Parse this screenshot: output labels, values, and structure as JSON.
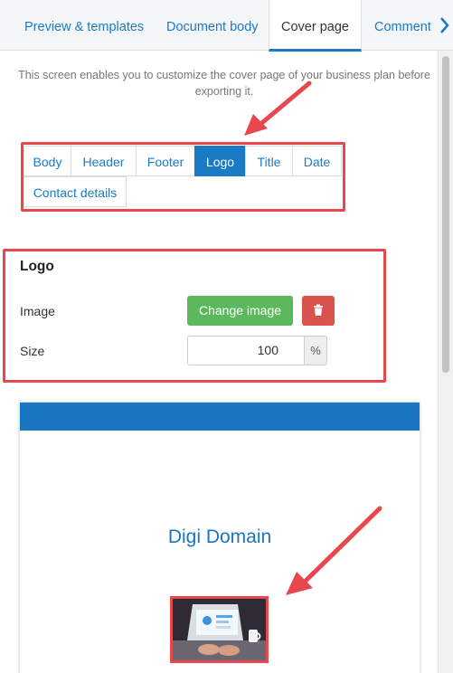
{
  "tabs": {
    "items": [
      {
        "label": "Preview & templates"
      },
      {
        "label": "Document body"
      },
      {
        "label": "Cover page",
        "active": true
      },
      {
        "label": "Comments"
      }
    ]
  },
  "intro_text": "This screen enables you to customize the cover page of your business plan before exporting it.",
  "subtabs": {
    "items": [
      {
        "label": "Body"
      },
      {
        "label": "Header"
      },
      {
        "label": "Footer"
      },
      {
        "label": "Logo",
        "active": true
      },
      {
        "label": "Title"
      },
      {
        "label": "Date"
      },
      {
        "label": "Contact details"
      }
    ]
  },
  "logo_section": {
    "title": "Logo",
    "image_label": "Image",
    "change_button": "Change image",
    "delete_icon": "trash-icon",
    "size_label": "Size",
    "size_value": "100",
    "size_unit": "%"
  },
  "preview": {
    "company_name": "Digi Domain",
    "header_color": "#1a75c2"
  },
  "colors": {
    "accent": "#1a7bc4",
    "annotation": "#e8474d",
    "success": "#5cb85c",
    "danger": "#d9534f"
  }
}
